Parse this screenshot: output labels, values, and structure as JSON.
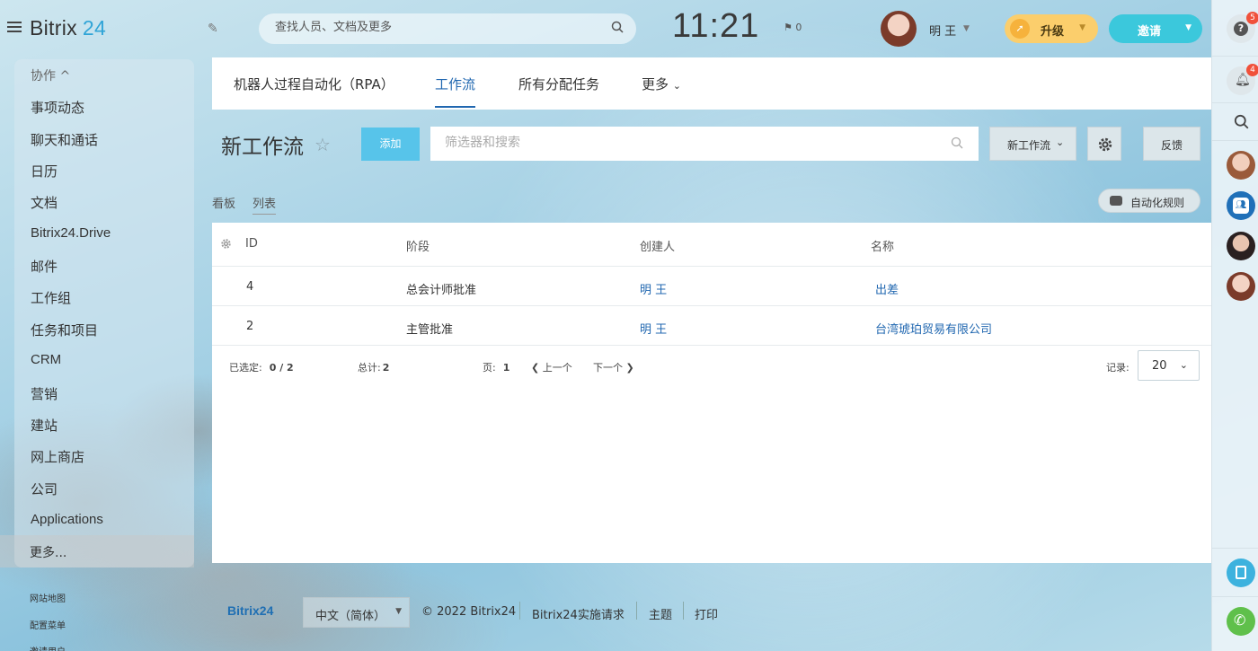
{
  "header": {
    "logo_text": "Bitrix",
    "logo_number": "24",
    "search_placeholder": "查找人员、文档及更多",
    "clock": "11:21",
    "flag_count": "0",
    "user_name": "明 王",
    "upgrade_label": "升级",
    "invite_label": "邀请"
  },
  "sidebar": {
    "section_label": "协作 ^",
    "items": [
      {
        "label": "事项动态"
      },
      {
        "label": "聊天和通话"
      },
      {
        "label": "日历"
      },
      {
        "label": "文档"
      },
      {
        "label": "Bitrix24.Drive"
      },
      {
        "label": "邮件"
      },
      {
        "label": "工作组"
      },
      {
        "label": "任务和项目"
      },
      {
        "label": "CRM"
      },
      {
        "label": "营销"
      },
      {
        "label": "建站"
      },
      {
        "label": "网上商店"
      },
      {
        "label": "公司"
      },
      {
        "label": "Applications"
      }
    ],
    "more_label": "更多...",
    "footer_links": [
      {
        "label": "网站地图"
      },
      {
        "label": "配置菜单"
      },
      {
        "label": "邀请用户"
      }
    ]
  },
  "tabs": [
    {
      "label": "机器人过程自动化（RPA）"
    },
    {
      "label": "工作流"
    },
    {
      "label": "所有分配任务"
    },
    {
      "label": "更多"
    }
  ],
  "toolbar": {
    "title": "新工作流",
    "add_label": "添加",
    "filter_placeholder": "筛选器和搜索",
    "new_workflow_label": "新工作流",
    "feedback_label": "反馈"
  },
  "views": {
    "kanban_label": "看板",
    "list_label": "列表",
    "automation_label": "自动化规则"
  },
  "grid": {
    "columns": [
      "ID",
      "阶段",
      "创建人",
      "名称"
    ],
    "rows": [
      {
        "id": "4",
        "stage": "总会计师批准",
        "creator": "明 王",
        "name": "出差"
      },
      {
        "id": "2",
        "stage": "主管批准",
        "creator": "明 王",
        "name": "台湾琥珀贸易有限公司"
      }
    ],
    "selected_label": "已选定:",
    "selected_value": "0 / 2",
    "total_label": "总计:",
    "total_value": "2",
    "page_label": "页:",
    "page_value": "1",
    "prev_label": "上一个",
    "next_label": "下一个",
    "records_label": "记录:",
    "records_value": "20"
  },
  "footer": {
    "logo": "Bitrix24",
    "language": "中文（简体）",
    "copyright": "© 2022 Bitrix24",
    "implementation": "Bitrix24实施请求",
    "theme": "主题",
    "print": "打印"
  },
  "rail": {
    "help_badge": "5",
    "notify_badge": "4"
  },
  "colors": {
    "accent_blue": "#2067b0",
    "add_button": "#57c4ea",
    "upgrade": "#fbce6c",
    "invite": "#3bc8dc"
  }
}
